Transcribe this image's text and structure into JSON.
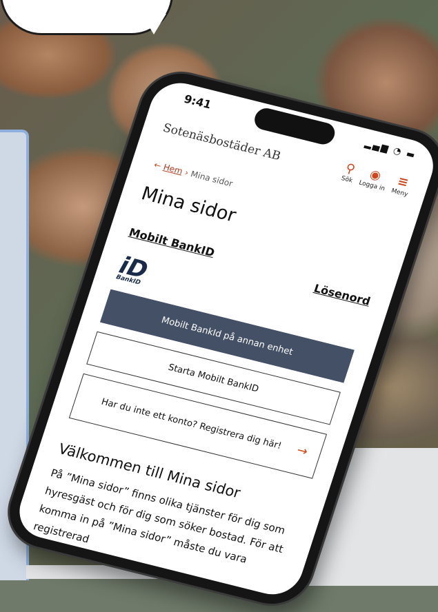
{
  "status": {
    "time": "9:41",
    "icons": "▂▄▆ ◔ ▬"
  },
  "header": {
    "brand": "Sotenäsbostäder AB",
    "nav": [
      {
        "label": "Sök",
        "icon": "search-icon"
      },
      {
        "label": "Logga in",
        "icon": "user-icon"
      },
      {
        "label": "Meny",
        "icon": "menu-icon"
      }
    ]
  },
  "breadcrumb": {
    "home": "Hem",
    "current": "Mina sidor"
  },
  "page": {
    "title": "Mina sidor"
  },
  "tabs": {
    "bankid": "Mobilt BankID",
    "password": "Lösenord"
  },
  "bankid_logo": {
    "label": "BankID"
  },
  "buttons": {
    "other_device": "Mobilt BankId på annan enhet",
    "start": "Starta Mobilt BankID",
    "register": "Har du inte ett konto? Registrera dig här!"
  },
  "welcome": {
    "heading": "Välkommen till Mina sidor",
    "text": "På ”Mina sidor” finns olika tjänster för dig som hyresgäst och för dig som söker bostad. För att komma in på ”Mina sidor” måste du vara registrerad"
  },
  "colors": {
    "accent": "#d0451b",
    "primary_button": "#445066"
  }
}
